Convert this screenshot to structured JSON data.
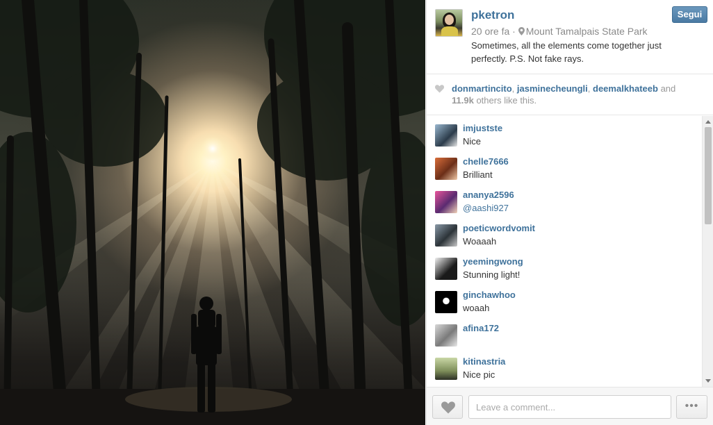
{
  "post": {
    "username": "pketron",
    "time": "20 ore fa",
    "separator": "·",
    "location": "Mount Tamalpais State Park",
    "caption": "Sometimes, all the elements come together just perfectly. P.S. Not fake rays. ",
    "follow_label": "Segui"
  },
  "likes": {
    "users": [
      "donmartincito",
      "jasminecheungli",
      "deemalkhateeb"
    ],
    "and_text": "and",
    "others_count": "11.9k",
    "others_text": "others like this."
  },
  "comments": [
    {
      "user": "imjustste",
      "text": "Nice"
    },
    {
      "user": "chelle7666",
      "text": "Brilliant"
    },
    {
      "user": "ananya2596",
      "text": "@aashi927"
    },
    {
      "user": "poeticwordvomit",
      "text": "Woaaah "
    },
    {
      "user": "yeemingwong",
      "text": "Stunning light!"
    },
    {
      "user": "ginchawhoo",
      "text": "woaah"
    },
    {
      "user": "afina172",
      "text": ""
    },
    {
      "user": "kitinastria",
      "text": "Nice pic"
    }
  ],
  "footer": {
    "comment_placeholder": "Leave a comment...",
    "more_label": "•••"
  },
  "colors": {
    "link": "#3f729b",
    "follow_button": "#4a7aa3",
    "muted": "#999999"
  },
  "icons": [
    "heart-icon",
    "location-pin-icon",
    "more-options-icon"
  ]
}
